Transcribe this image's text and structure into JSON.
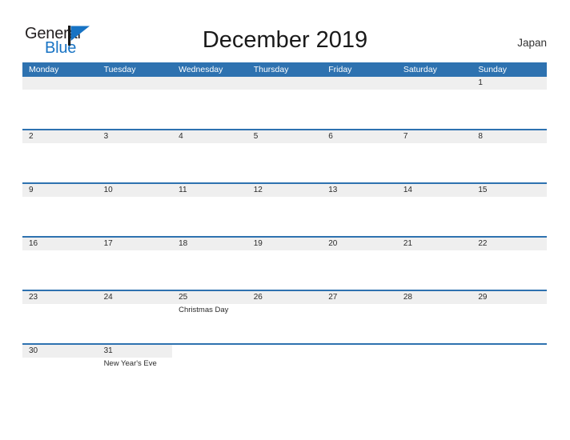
{
  "brand": {
    "name_part1": "General",
    "name_part2": "Blue",
    "flag_color": "#1773c4"
  },
  "header": {
    "title": "December 2019",
    "region": "Japan"
  },
  "theme": {
    "header_blue": "#2e72b0",
    "row_separator_blue": "#2e72b0",
    "daynum_band_gray": "#efefef",
    "text_dark": "#2b2b2b"
  },
  "calendar": {
    "weekdays": [
      "Monday",
      "Tuesday",
      "Wednesday",
      "Thursday",
      "Friday",
      "Saturday",
      "Sunday"
    ],
    "weeks": [
      {
        "band_full": true,
        "days": [
          {
            "num": "",
            "events": []
          },
          {
            "num": "",
            "events": []
          },
          {
            "num": "",
            "events": []
          },
          {
            "num": "",
            "events": []
          },
          {
            "num": "",
            "events": []
          },
          {
            "num": "",
            "events": []
          },
          {
            "num": "1",
            "events": []
          }
        ]
      },
      {
        "band_full": true,
        "days": [
          {
            "num": "2",
            "events": []
          },
          {
            "num": "3",
            "events": []
          },
          {
            "num": "4",
            "events": []
          },
          {
            "num": "5",
            "events": []
          },
          {
            "num": "6",
            "events": []
          },
          {
            "num": "7",
            "events": []
          },
          {
            "num": "8",
            "events": []
          }
        ]
      },
      {
        "band_full": true,
        "days": [
          {
            "num": "9",
            "events": []
          },
          {
            "num": "10",
            "events": []
          },
          {
            "num": "11",
            "events": []
          },
          {
            "num": "12",
            "events": []
          },
          {
            "num": "13",
            "events": []
          },
          {
            "num": "14",
            "events": []
          },
          {
            "num": "15",
            "events": []
          }
        ]
      },
      {
        "band_full": true,
        "days": [
          {
            "num": "16",
            "events": []
          },
          {
            "num": "17",
            "events": []
          },
          {
            "num": "18",
            "events": []
          },
          {
            "num": "19",
            "events": []
          },
          {
            "num": "20",
            "events": []
          },
          {
            "num": "21",
            "events": []
          },
          {
            "num": "22",
            "events": []
          }
        ]
      },
      {
        "band_full": true,
        "days": [
          {
            "num": "23",
            "events": []
          },
          {
            "num": "24",
            "events": []
          },
          {
            "num": "25",
            "events": [
              "Christmas Day"
            ]
          },
          {
            "num": "26",
            "events": []
          },
          {
            "num": "27",
            "events": []
          },
          {
            "num": "28",
            "events": []
          },
          {
            "num": "29",
            "events": []
          }
        ]
      },
      {
        "band_full": false,
        "days": [
          {
            "num": "30",
            "events": []
          },
          {
            "num": "31",
            "events": [
              "New Year's Eve"
            ]
          },
          {
            "num": "",
            "events": []
          },
          {
            "num": "",
            "events": []
          },
          {
            "num": "",
            "events": []
          },
          {
            "num": "",
            "events": []
          },
          {
            "num": "",
            "events": []
          }
        ]
      }
    ]
  }
}
